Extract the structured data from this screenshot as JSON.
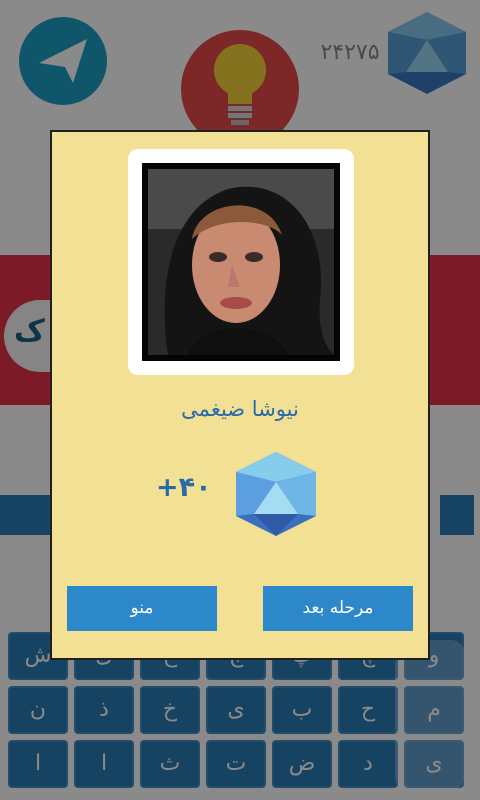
{
  "header": {
    "score": "۲۴۲۷۵"
  },
  "answer_area": {
    "tag_text": "ک"
  },
  "keyboard": {
    "rows": [
      [
        "و",
        "چ",
        "پ",
        "ج",
        "ح",
        "ی",
        "ش"
      ],
      [
        "م",
        "ح",
        "ب",
        "ی",
        "خ",
        "ذ",
        "ن"
      ],
      [
        "ی",
        "د",
        "ض",
        "ت",
        "ث",
        "ا",
        "ا"
      ]
    ]
  },
  "dialog": {
    "celebrity_name": "نیوشا ضیغمی",
    "reward_text": "+۴۰",
    "menu_button": "منو",
    "next_button": "مرحله بعد"
  },
  "colors": {
    "dialog_bg": "#f2e095",
    "accent_blue": "#2c88c8",
    "answer_red": "#e8304a"
  },
  "icons": {
    "back": "back-arrow-icon",
    "hint": "lightbulb-icon",
    "score": "diamond-gem-icon",
    "reward": "diamond-gem-icon"
  }
}
